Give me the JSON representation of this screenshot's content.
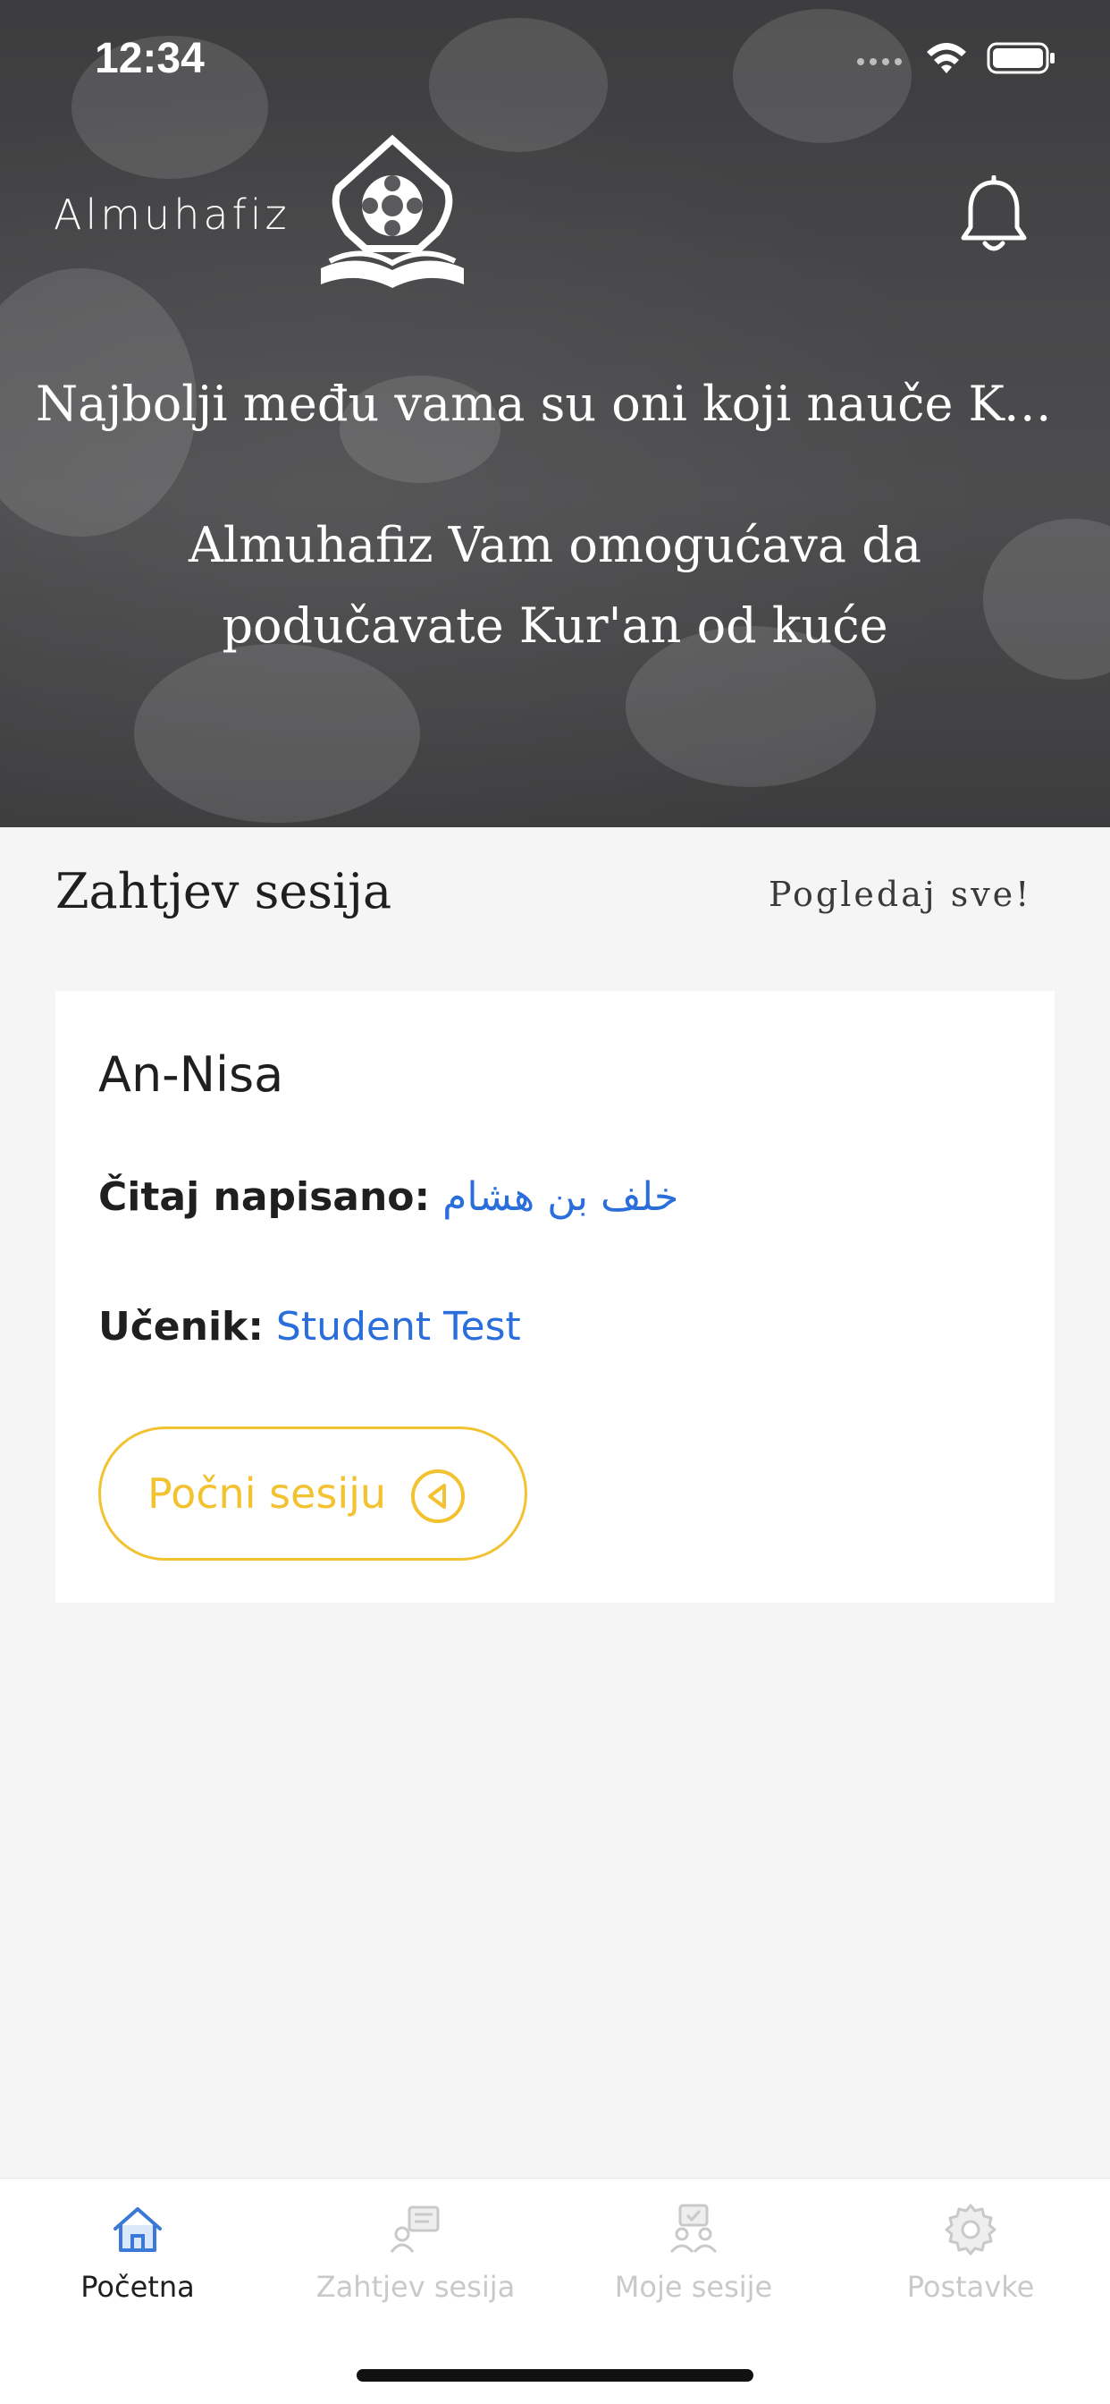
{
  "status_bar": {
    "time": "12:34"
  },
  "header": {
    "brand_name": "Almuhafiz",
    "tagline": "Najbolji među vama su oni koji nauče Kur...",
    "subline": "Almuhafiz Vam omogućava da podučavate Kur'an od kuće"
  },
  "section": {
    "title": "Zahtjev sesija",
    "view_all": "Pogledaj sve!"
  },
  "card": {
    "surah": "An-Nisa",
    "read_label": "Čitaj napisano:",
    "read_value": "خلف بن هشام",
    "student_label": "Učenik:",
    "student_value": "Student Test",
    "start_button": "Počni sesiju"
  },
  "tabs": [
    {
      "label": "Početna",
      "icon": "home-icon",
      "active": true
    },
    {
      "label": "Zahtjev sesija",
      "icon": "request-session-icon",
      "active": false
    },
    {
      "label": "Moje sesije",
      "icon": "my-sessions-icon",
      "active": false
    },
    {
      "label": "Postavke",
      "icon": "settings-icon",
      "active": false
    }
  ],
  "colors": {
    "accent_yellow": "#f2c230",
    "link_blue": "#2a6edb",
    "active_tab_icon": "#3b78d8",
    "inactive_tab": "#c9c9c9"
  }
}
